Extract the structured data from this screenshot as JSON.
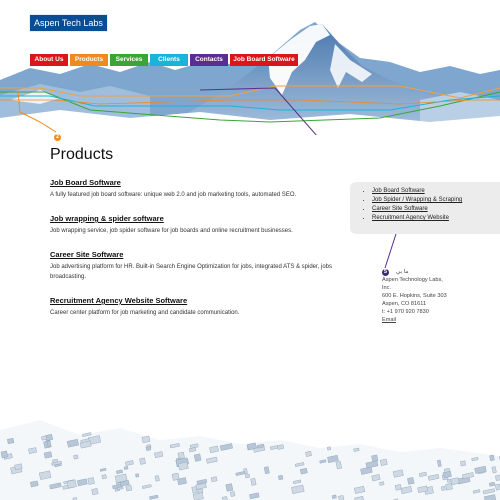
{
  "header": {
    "logo_text": "Aspen Tech Labs",
    "nav": [
      {
        "label": "About Us",
        "color": "#d8161c"
      },
      {
        "label": "Products",
        "color": "#f08a1c"
      },
      {
        "label": "Services",
        "color": "#3aa535"
      },
      {
        "label": "Clients",
        "color": "#19b4d8"
      },
      {
        "label": "Contacts",
        "color": "#5b2d8e"
      },
      {
        "label": "Job Board Software",
        "color": "#d8161c"
      }
    ],
    "marker_label": "2"
  },
  "main": {
    "title": "Products",
    "products": [
      {
        "title": "Job Board Software",
        "description": "A fully featured job board software: unique web 2.0 and job marketing  tools, automated SEO."
      },
      {
        "title": "Job wrapping & spider software",
        "description": "Job wrapping service, job spider software for job boards and online recruitment businesses."
      },
      {
        "title": "Career Site Software",
        "description": "Job advertising platform for HR. Built-in Search Engine Optimization for jobs, integrated ATS & spider, jobs broadcasting."
      },
      {
        "title": "Recruitment Agency Website Software",
        "description": "Career center platform for job marketing and candidate communication."
      }
    ]
  },
  "sidebar": {
    "links": [
      "Job Board Software",
      "Job Spider / Wrapping & Scraping",
      "Career Site Software",
      "Recruitment Agency Website"
    ]
  },
  "contact": {
    "marker_label": "5",
    "heading": "ما بي",
    "lines": [
      "Aspen Technology Labs,",
      "Inc.",
      "600 E. Hopkins, Suite 303",
      "Aspen, CO 81611",
      "t: +1 970 920 7830"
    ],
    "email": "Email"
  },
  "colors": {
    "accent": "#5b2d8e",
    "orange": "#f08a1c",
    "logo_bg": "#0a4d92"
  }
}
